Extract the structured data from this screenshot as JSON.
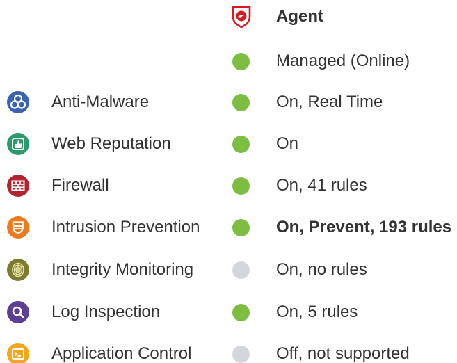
{
  "header": {
    "title": "Agent",
    "icon": "trend-micro-shield-icon",
    "brand_color": "#d71921"
  },
  "agent_status": {
    "text": "Managed (Online)",
    "state": "on"
  },
  "colors": {
    "status_on": "#7cbd42",
    "status_off": "#d3d7db"
  },
  "modules": [
    {
      "label": "Anti-Malware",
      "icon": "biohazard-icon",
      "icon_color": "#3b63b5",
      "status": "On, Real Time",
      "state": "on"
    },
    {
      "label": "Web Reputation",
      "icon": "thumbs-up-icon",
      "icon_color": "#2e9a6b",
      "status": "On",
      "state": "on"
    },
    {
      "label": "Firewall",
      "icon": "brick-wall-icon",
      "icon_color": "#b3232d",
      "status": "On, 41 rules",
      "state": "on"
    },
    {
      "label": "Intrusion Prevention",
      "icon": "shield-icon",
      "icon_color": "#ef7a1e",
      "status": "On, Prevent, 193 rules",
      "state": "on",
      "emphasis": true
    },
    {
      "label": "Integrity Monitoring",
      "icon": "fingerprint-icon",
      "icon_color": "#7d7b2f",
      "status": "On, no rules",
      "state": "off"
    },
    {
      "label": "Log Inspection",
      "icon": "magnifier-icon",
      "icon_color": "#5b3f95",
      "status": "On, 5 rules",
      "state": "on"
    },
    {
      "label": "Application Control",
      "icon": "application-icon",
      "icon_color": "#f2a81d",
      "status": "Off, not supported",
      "state": "off"
    }
  ]
}
